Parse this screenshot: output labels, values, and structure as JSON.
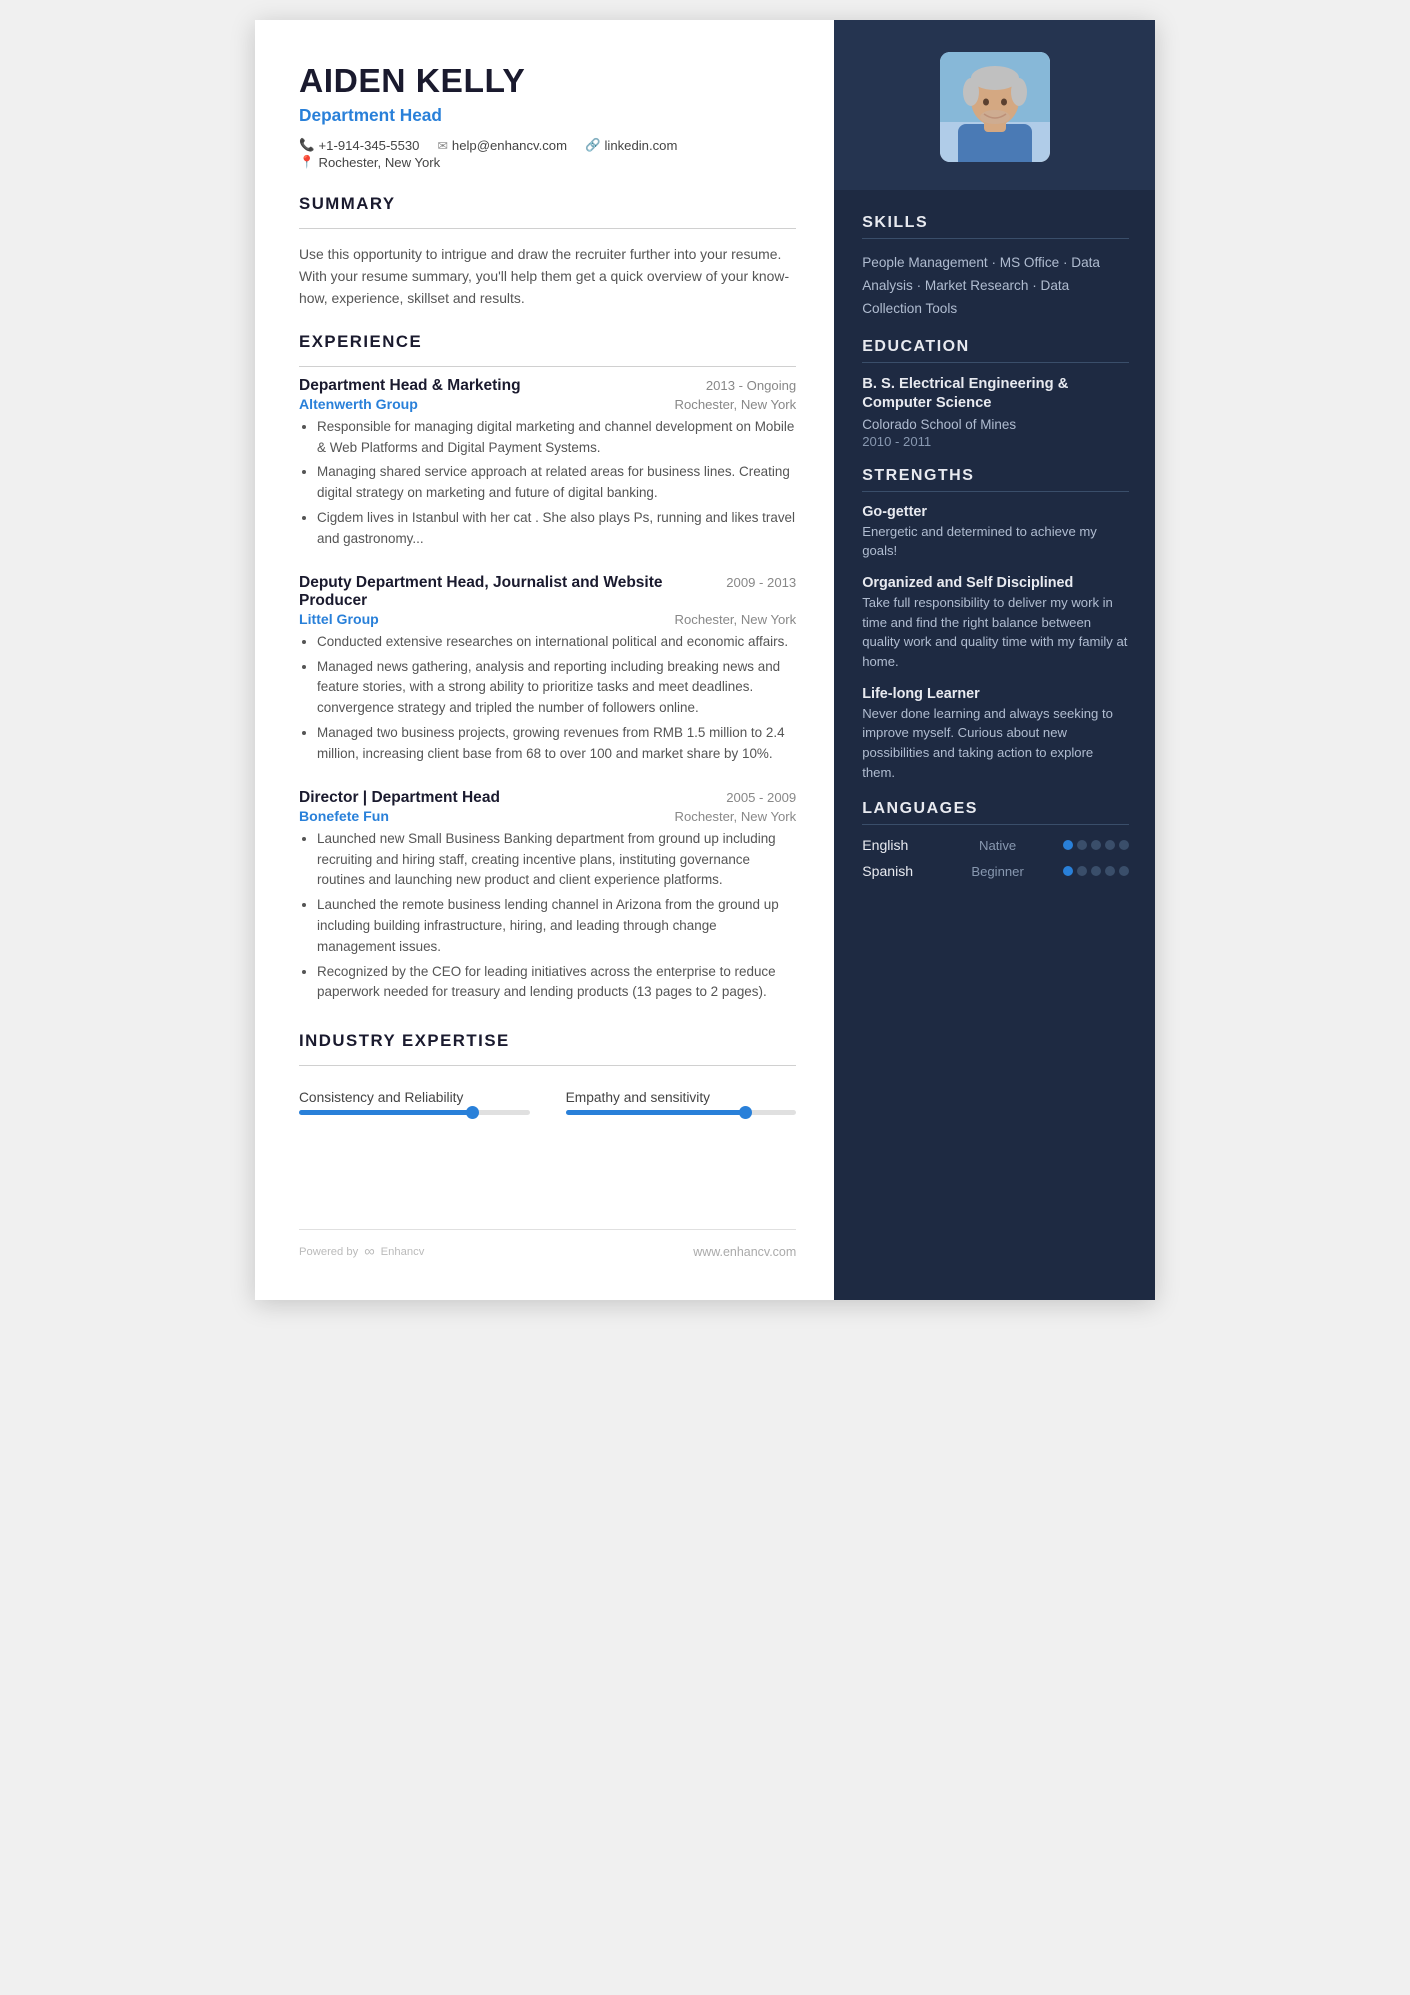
{
  "header": {
    "name": "AIDEN KELLY",
    "title": "Department Head",
    "phone": "+1-914-345-5530",
    "email": "help@enhancv.com",
    "linkedin": "linkedin.com",
    "location": "Rochester, New York"
  },
  "summary": {
    "section_title": "SUMMARY",
    "text": "Use this opportunity to intrigue and draw the recruiter further into your resume. With your resume summary, you'll help them get a quick overview of your know-how, experience, skillset and results."
  },
  "experience": {
    "section_title": "EXPERIENCE",
    "jobs": [
      {
        "title": "Department Head & Marketing",
        "date": "2013 - Ongoing",
        "company": "Altenwerth Group",
        "location": "Rochester, New York",
        "bullets": [
          "Responsible for managing digital marketing and channel development on Mobile & Web Platforms and Digital Payment Systems.",
          "Managing shared service approach at related areas for business lines. Creating digital strategy on marketing and future of digital banking.",
          "Cigdem lives in Istanbul with her cat . She also plays Ps, running and likes travel and gastronomy..."
        ]
      },
      {
        "title": "Deputy Department Head, Journalist and Website Producer",
        "date": "2009 - 2013",
        "company": "Littel Group",
        "location": "Rochester, New York",
        "bullets": [
          "Conducted extensive researches on international political and economic affairs.",
          "Managed news gathering, analysis and reporting including breaking news and feature stories, with a strong ability to prioritize tasks and meet deadlines. convergence strategy and tripled the number of followers online.",
          "Managed two business projects, growing revenues from RMB 1.5 million to 2.4 million, increasing client base from 68 to over 100 and market share by 10%."
        ]
      },
      {
        "title": "Director | Department Head",
        "date": "2005 - 2009",
        "company": "Bonefete Fun",
        "location": "Rochester, New York",
        "bullets": [
          "Launched new Small Business Banking department from ground up including recruiting and hiring staff, creating incentive plans, instituting governance routines and launching new product and client experience platforms.",
          "Launched the remote business lending channel in Arizona from the ground up including building infrastructure, hiring, and leading through change management issues.",
          "Recognized by the CEO for leading initiatives across the enterprise to reduce paperwork needed for treasury and lending products (13 pages to 2 pages)."
        ]
      }
    ]
  },
  "industry_expertise": {
    "section_title": "INDUSTRY EXPERTISE",
    "items": [
      {
        "label": "Consistency and Reliability",
        "fill_pct": 75
      },
      {
        "label": "Empathy and sensitivity",
        "fill_pct": 78
      }
    ]
  },
  "footer": {
    "powered_by": "Powered by",
    "brand": "Enhancv",
    "website": "www.enhancv.com"
  },
  "skills": {
    "section_title": "SKILLS",
    "text": "People Management · MS Office · Data Analysis · Market Research · Data Collection Tools"
  },
  "education": {
    "section_title": "EDUCATION",
    "degree": "B. S. Electrical Engineering & Computer Science",
    "school": "Colorado School of Mines",
    "dates": "2010 - 2011"
  },
  "strengths": {
    "section_title": "STRENGTHS",
    "items": [
      {
        "name": "Go-getter",
        "desc": "Energetic and determined to achieve my goals!"
      },
      {
        "name": "Organized and Self Disciplined",
        "desc": "Take full responsibility to deliver my work in time and find the right balance between quality work and quality time with my family at home."
      },
      {
        "name": "Life-long Learner",
        "desc": "Never done learning and always seeking to improve myself. Curious about new possibilities and taking action to explore them."
      }
    ]
  },
  "languages": {
    "section_title": "LANGUAGES",
    "items": [
      {
        "name": "English",
        "level": "Native",
        "filled": 1,
        "total": 5
      },
      {
        "name": "Spanish",
        "level": "Beginner",
        "filled": 1,
        "total": 5
      }
    ]
  }
}
